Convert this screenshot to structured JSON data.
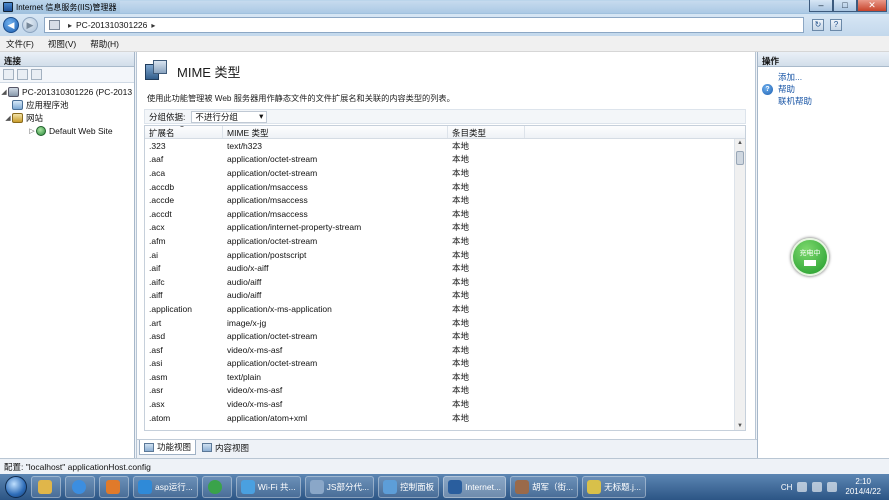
{
  "window": {
    "title": "Internet 信息服务(IIS)管理器",
    "buttons": {
      "minimize": "–",
      "maximize": "□",
      "close": "✕"
    }
  },
  "address": {
    "separator": "▸",
    "path": [
      "PC-201310301226"
    ]
  },
  "menu": [
    "文件(F)",
    "视图(V)",
    "帮助(H)"
  ],
  "left_pane": {
    "header": "连接",
    "tree": [
      {
        "label": "PC-201310301226 (PC-2013",
        "expanded": true
      },
      {
        "label": "应用程序池"
      },
      {
        "label": "网站",
        "expanded": true
      },
      {
        "label": "Default Web Site"
      }
    ]
  },
  "center": {
    "title": "MIME 类型",
    "description": "使用此功能管理被 Web 服务器用作静态文件的文件扩展名和关联的内容类型的列表。",
    "group_by_label": "分组依据:",
    "group_by_value": "不进行分组",
    "columns": [
      "扩展名",
      "MIME 类型",
      "条目类型"
    ],
    "rows": [
      [
        ".323",
        "text/h323",
        "本地"
      ],
      [
        ".aaf",
        "application/octet-stream",
        "本地"
      ],
      [
        ".aca",
        "application/octet-stream",
        "本地"
      ],
      [
        ".accdb",
        "application/msaccess",
        "本地"
      ],
      [
        ".accde",
        "application/msaccess",
        "本地"
      ],
      [
        ".accdt",
        "application/msaccess",
        "本地"
      ],
      [
        ".acx",
        "application/internet-property-stream",
        "本地"
      ],
      [
        ".afm",
        "application/octet-stream",
        "本地"
      ],
      [
        ".ai",
        "application/postscript",
        "本地"
      ],
      [
        ".aif",
        "audio/x-aiff",
        "本地"
      ],
      [
        ".aifc",
        "audio/aiff",
        "本地"
      ],
      [
        ".aiff",
        "audio/aiff",
        "本地"
      ],
      [
        ".application",
        "application/x-ms-application",
        "本地"
      ],
      [
        ".art",
        "image/x-jg",
        "本地"
      ],
      [
        ".asd",
        "application/octet-stream",
        "本地"
      ],
      [
        ".asf",
        "video/x-ms-asf",
        "本地"
      ],
      [
        ".asi",
        "application/octet-stream",
        "本地"
      ],
      [
        ".asm",
        "text/plain",
        "本地"
      ],
      [
        ".asr",
        "video/x-ms-asf",
        "本地"
      ],
      [
        ".asx",
        "video/x-ms-asf",
        "本地"
      ],
      [
        ".atom",
        "application/atom+xml",
        "本地"
      ]
    ],
    "view_tabs": [
      "功能视图",
      "内容视图"
    ]
  },
  "right_pane": {
    "header": "操作",
    "actions": [
      "添加..."
    ],
    "help": [
      "帮助",
      "联机帮助"
    ]
  },
  "charge_widget": {
    "label": "充电中"
  },
  "statusbar": {
    "text": "配置: \"localhost\" applicationHost.config"
  },
  "taskbar": {
    "apps": [
      "asp运行...",
      "Wi-Fi 共...",
      "JS部分代...",
      "控制面板",
      "Internet...",
      "胡军（街...",
      "无标题.j..."
    ],
    "lang": "CH",
    "time": "2:10",
    "date": "2014/4/22"
  },
  "colors": {
    "accent": "#1a56a6",
    "taskbar": "#2c5585",
    "charge": "#1f9a2a"
  }
}
